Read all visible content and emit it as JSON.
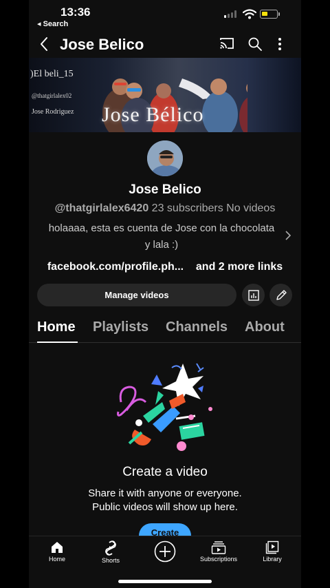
{
  "status_bar": {
    "time": "13:36",
    "back_app": "◂ Search"
  },
  "app_bar": {
    "title": "Jose Belico",
    "icons": [
      "back-arrow-icon",
      "cast-icon",
      "search-icon",
      "more-vert-icon"
    ]
  },
  "banner": {
    "line1": ")El beli_15",
    "line2": "@thatgirlalex02",
    "line3": "Jose Rodriguez",
    "big_text": "Jose Bélico"
  },
  "channel": {
    "name": "Jose Belico",
    "handle": "@thatgirlalex6420",
    "subscribers": "23 subscribers",
    "videos": "No videos",
    "description": "holaaaa, esta es cuenta de Jose con la chocolata y lala :)",
    "link": "facebook.com/profile.ph...",
    "more_links": "and 2 more links",
    "manage_button": "Manage videos"
  },
  "tabs": [
    {
      "label": "Home",
      "active": true
    },
    {
      "label": "Playlists",
      "active": false
    },
    {
      "label": "Channels",
      "active": false
    },
    {
      "label": "About",
      "active": false
    }
  ],
  "empty_state": {
    "title": "Create a video",
    "line1": "Share it with anyone or everyone.",
    "line2": "Public videos will show up here.",
    "button": "Create"
  },
  "bottom_nav": [
    {
      "label": "Home",
      "icon": "home-icon"
    },
    {
      "label": "Shorts",
      "icon": "shorts-icon"
    },
    {
      "label": "",
      "icon": "add-circle-icon"
    },
    {
      "label": "Subscriptions",
      "icon": "subscriptions-icon"
    },
    {
      "label": "Library",
      "icon": "library-icon"
    }
  ],
  "colors": {
    "background": "#0f0f0f",
    "chip": "#272727",
    "accent_blue": "#3ea6ff",
    "battery": "#f5e10c"
  }
}
